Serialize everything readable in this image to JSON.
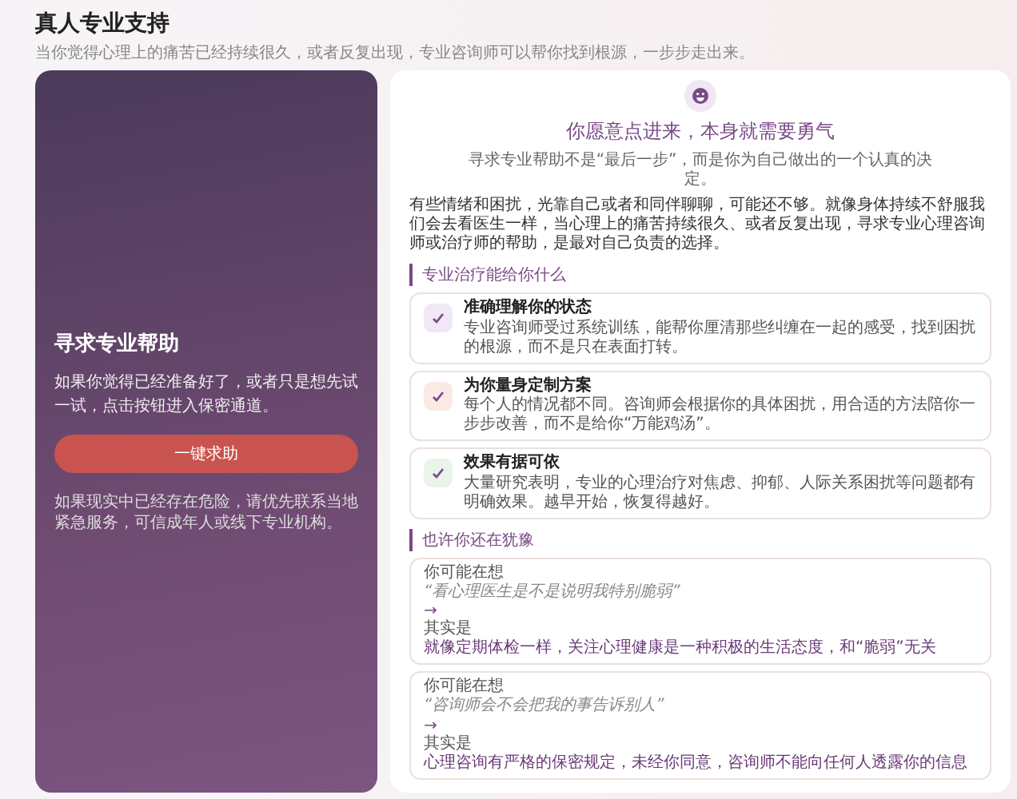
{
  "header": {
    "title": "真人专业支持",
    "subtitle": "当你觉得心理上的痛苦已经持续很久，或者反复出现，专业咨询师可以帮你找到根源，一步步走出来。"
  },
  "help_panel": {
    "title": "寻求专业帮助",
    "description": "如果你觉得已经准备好了，或者只是想先试一试，点击按钮进入保密通道。",
    "button": "一键求助",
    "note": "如果现实中已经存在危险，请优先联系当地紧急服务，可信成年人或线下专业机构。"
  },
  "info_panel": {
    "headline": "你愿意点进来，本身就需要勇气",
    "subline": "寻求专业帮助不是“最后一步”，而是你为自己做出的一个认真的决定。",
    "paragraph": "有些情绪和困扰，光靠自己或者和同伴聊聊，可能还不够。就像身体持续不舒服我们会去看医生一样，当心理上的痛苦持续很久、或者反复出现，寻求专业心理咨询师或治疗师的帮助，是最对自己负责的选择。",
    "benefits_heading": "专业治疗能给你什么",
    "benefits": [
      {
        "title": "准确理解你的状态",
        "text": "专业咨询师受过系统训练，能帮你厘清那些纠缠在一起的感受，找到困扰的根源，而不是只在表面打转。",
        "color": "#f1e8f6"
      },
      {
        "title": "为你量身定制方案",
        "text": "每个人的情况都不同。咨询师会根据你的具体困扰，用合适的方法陪你一步步改善，而不是给你“万能鸡汤”。",
        "color": "#fbe9e4"
      },
      {
        "title": "效果有据可依",
        "text": "大量研究表明，专业的心理治疗对焦虑、抑郁、人际关系困扰等问题都有明确效果。越早开始，恢复得越好。",
        "color": "#eaf4ea"
      }
    ],
    "myths_heading": "也许你还在犹豫",
    "myths": [
      {
        "label": "你可能在想",
        "quote": "“看心理医生是不是说明我特别脆弱”",
        "arrow": "→",
        "answer_label": "其实是",
        "answer": "就像定期体检一样，关注心理健康是一种积极的生活态度，和“脆弱”无关"
      },
      {
        "label": "你可能在想",
        "quote": "“咨询师会不会把我的事告诉别人”",
        "arrow": "→",
        "answer_label": "其实是",
        "answer": "心理咨询有严格的保密规定，未经你同意，咨询师不能向任何人透露你的信息"
      }
    ]
  }
}
